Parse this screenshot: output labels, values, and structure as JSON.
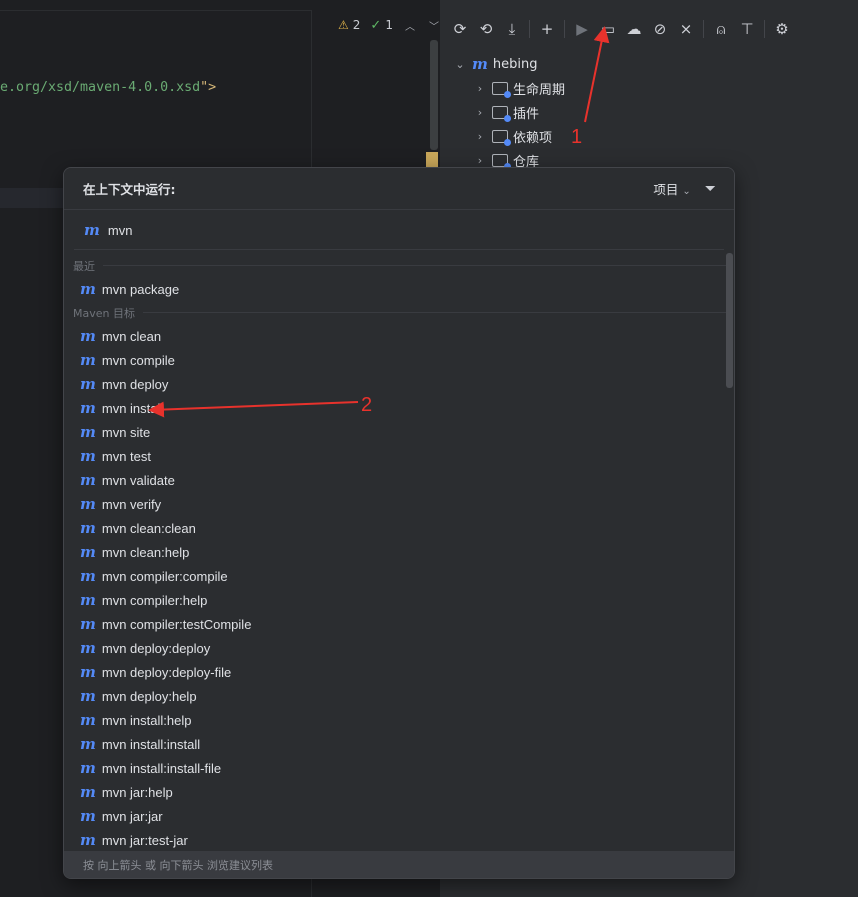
{
  "editor": {
    "inspection": {
      "warnings": "2",
      "weak_warnings": "1"
    },
    "code_text": "e.org/xsd/maven-4.0.0.xsd",
    "code_tag_end": "\">"
  },
  "maven_panel": {
    "tree": [
      {
        "label": "hebing",
        "icon": "maven-m-icon",
        "expanded": true
      },
      {
        "label": "生命周期",
        "icon": "folder-lifecycle-icon"
      },
      {
        "label": "插件",
        "icon": "folder-plugins-icon"
      },
      {
        "label": "依赖项",
        "icon": "folder-dependencies-icon"
      },
      {
        "label": "仓库",
        "icon": "folder-repositories-icon"
      }
    ],
    "toolbar_icons": [
      "reload-icon",
      "reload-folder-icon",
      "download-icon",
      "add-icon",
      "run-icon",
      "execute-goal-icon",
      "offline-icon",
      "skip-tests-icon",
      "collapse-icon",
      "show-dependencies-icon",
      "align-icon",
      "settings-icon"
    ]
  },
  "annotations": {
    "label1": "1",
    "label2": "2",
    "color": "#e8322c"
  },
  "popup": {
    "title": "在上下文中运行:",
    "scope": "项目",
    "search_value": "mvn ",
    "section_recent": "最近",
    "recent": [
      "mvn package"
    ],
    "section_goals": "Maven 目标",
    "goals": [
      "mvn clean",
      "mvn compile",
      "mvn deploy",
      "mvn install",
      "mvn site",
      "mvn test",
      "mvn validate",
      "mvn verify",
      "mvn clean:clean",
      "mvn clean:help",
      "mvn compiler:compile",
      "mvn compiler:help",
      "mvn compiler:testCompile",
      "mvn deploy:deploy",
      "mvn deploy:deploy-file",
      "mvn deploy:help",
      "mvn install:help",
      "mvn install:install",
      "mvn install:install-file",
      "mvn jar:help",
      "mvn jar:jar",
      "mvn jar:test-jar"
    ],
    "footer": "按 向上箭头 或 向下箭头 浏览建议列表"
  }
}
